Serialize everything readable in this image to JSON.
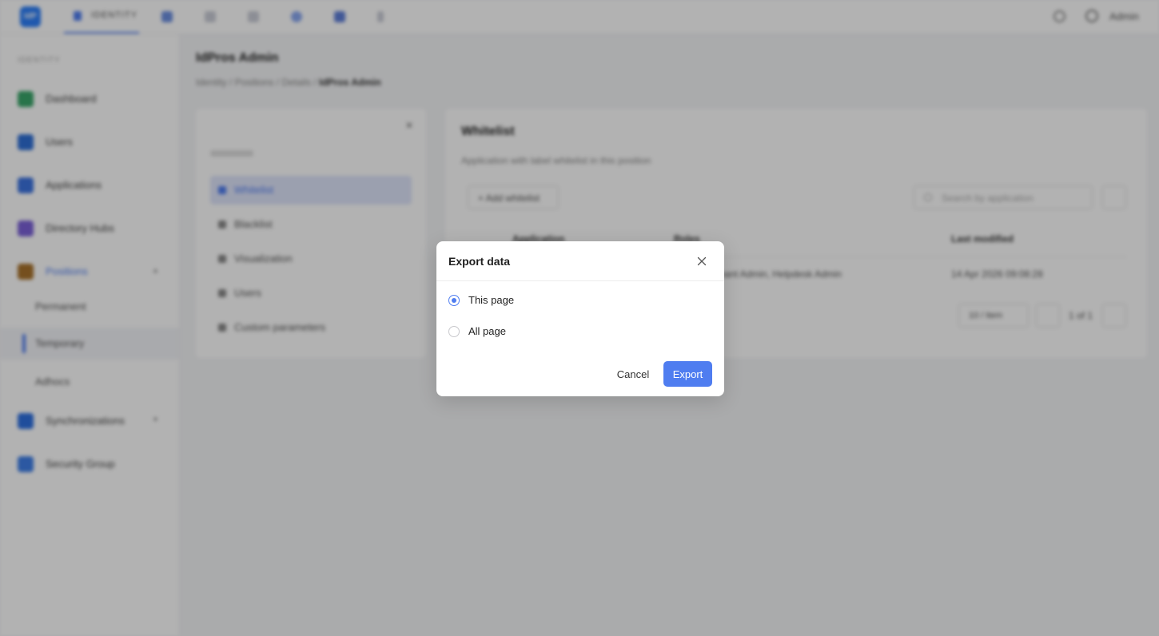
{
  "topbar": {
    "logo_text": "IdP",
    "active_tab": "IDENTITY",
    "icons": [
      "user-icon",
      "list-icon",
      "building-icon",
      "globe-icon",
      "settings-icon",
      "info-icon"
    ],
    "user_name": "Admin"
  },
  "sidebar": {
    "section_label": "IDENTITY",
    "items": [
      {
        "label": "Dashboard",
        "icon": "dashboard-icon",
        "color": "#3aa66a"
      },
      {
        "label": "Users",
        "icon": "user-icon",
        "color": "#2f6fd6"
      },
      {
        "label": "Applications",
        "icon": "applications-icon",
        "color": "#3c73e0"
      },
      {
        "label": "Directory Hubs",
        "icon": "directory-icon",
        "color": "#7b61d8"
      },
      {
        "label": "Positions",
        "icon": "briefcase-icon",
        "color": "#a8722b"
      },
      {
        "label": "Synchronizations",
        "icon": "sync-icon",
        "color": "#2d6fe0"
      },
      {
        "label": "Security Group",
        "icon": "shield-icon",
        "color": "#3f7fe8"
      }
    ],
    "sub_items": [
      "Permanent",
      "Temporary",
      "Adhocs"
    ]
  },
  "page": {
    "title": "IdPros Admin",
    "breadcrumb": [
      "Identity",
      "Positions",
      "Details",
      "IdPros Admin"
    ]
  },
  "left_card": {
    "items": [
      "Whitelist",
      "Blacklist",
      "Visualization",
      "Users",
      "Custom parameters"
    ]
  },
  "right_card": {
    "title": "Whitelist",
    "subtitle": "Application with label whitelist in this position",
    "add_button": "+ Add whitelist",
    "search_placeholder": "Search by application",
    "columns": [
      "Application",
      "Roles",
      "Last modified"
    ],
    "row": {
      "roles": "Tenant Admin, Helpdesk Admin",
      "last_modified": "14 Apr 2026 09:08:28"
    },
    "page_size": "10 / item",
    "page_info": "1 of 1"
  },
  "modal": {
    "title": "Export data",
    "options": [
      {
        "label": "This page",
        "checked": true
      },
      {
        "label": "All page",
        "checked": false
      }
    ],
    "cancel_label": "Cancel",
    "export_label": "Export",
    "accent_color": "#4f7df0"
  }
}
